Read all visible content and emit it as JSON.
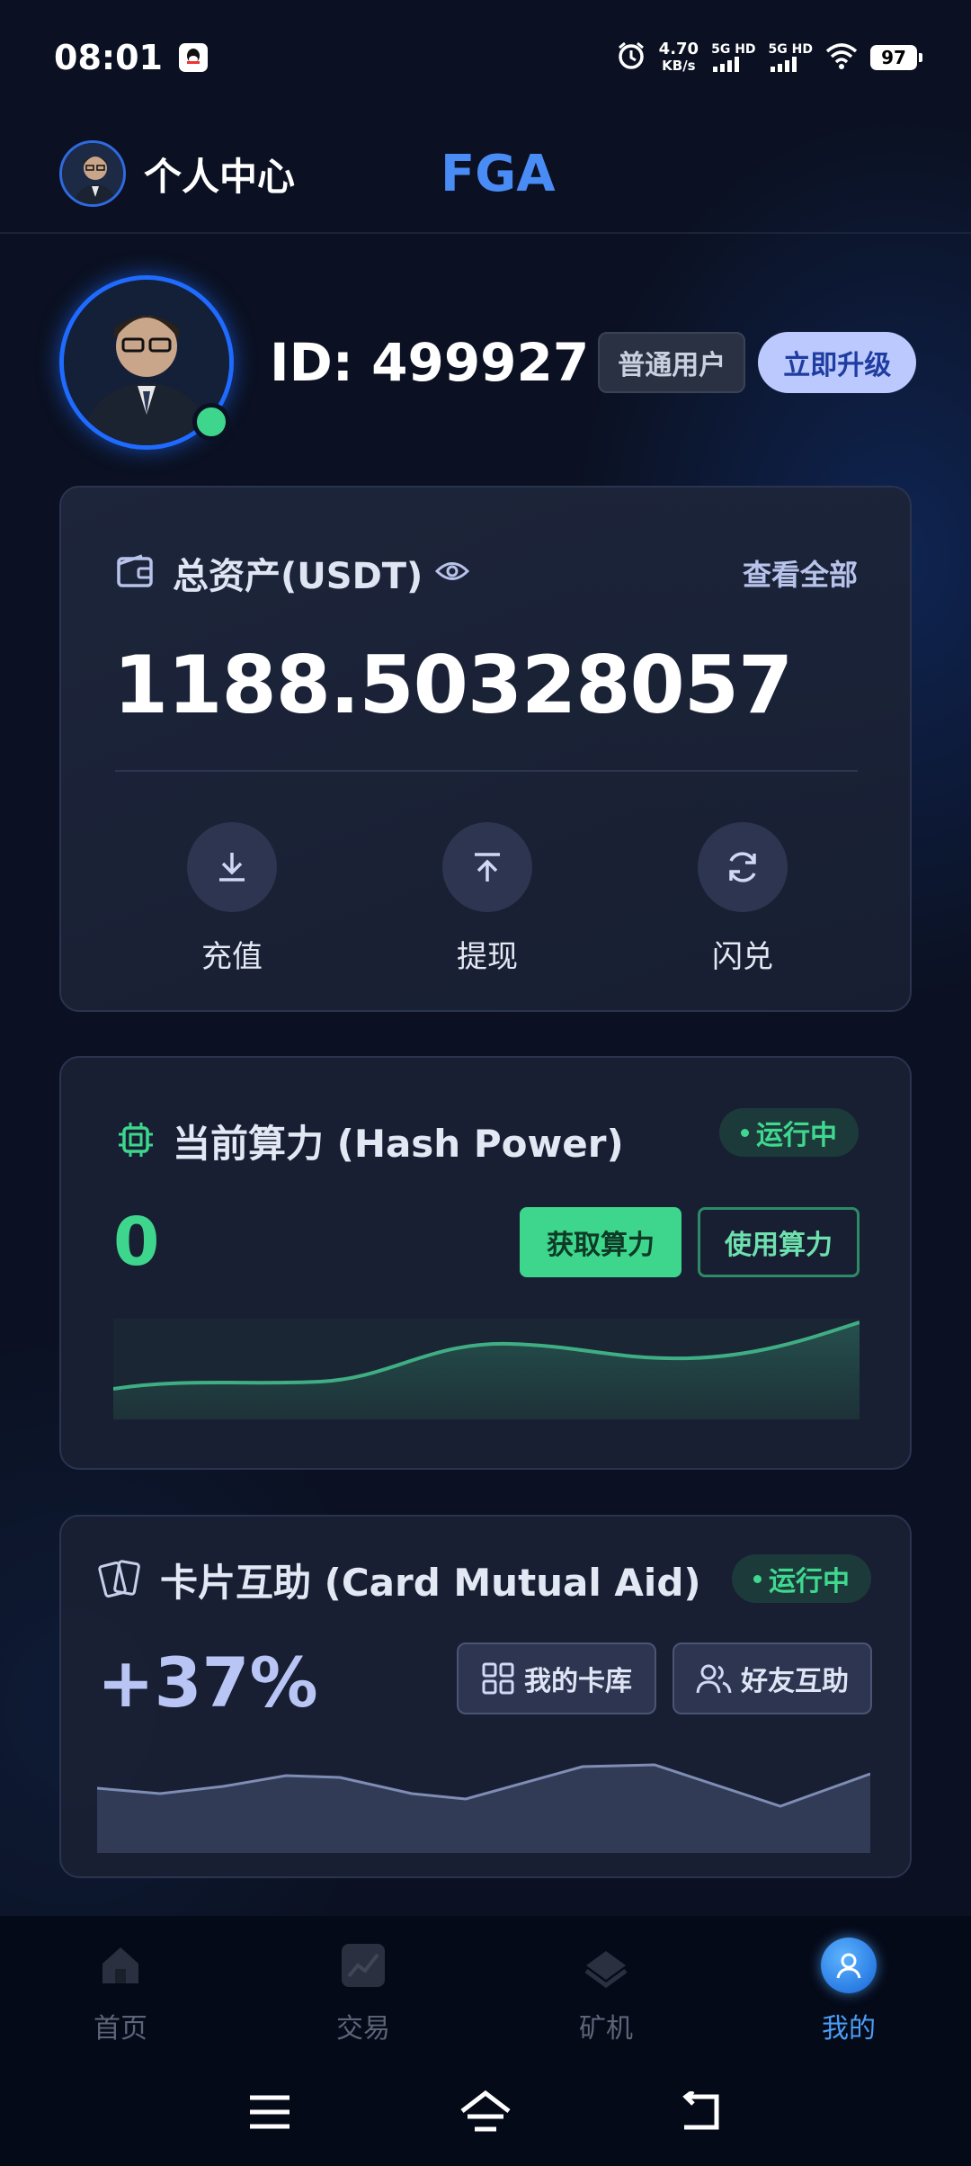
{
  "status_bar": {
    "time": "08:01",
    "net_speed_value": "4.70",
    "net_speed_unit": "KB/s",
    "sim1": "5G HD",
    "sim2": "5G HD",
    "battery": "97"
  },
  "header": {
    "title": "个人中心",
    "app_name": "FGA"
  },
  "profile": {
    "user_id": "ID: 499927",
    "tier": "普通用户",
    "upgrade_label": "立即升级",
    "online": true
  },
  "assets": {
    "label": "总资产(USDT)",
    "view_all": "查看全部",
    "total": "1188.50328057",
    "actions": [
      {
        "label": "充值",
        "icon": "download-icon"
      },
      {
        "label": "提现",
        "icon": "upload-icon"
      },
      {
        "label": "闪兑",
        "icon": "swap-icon"
      }
    ]
  },
  "hash_power": {
    "title": "当前算力 (Hash Power)",
    "status": "运行中",
    "value": "0",
    "get_label": "获取算力",
    "use_label": "使用算力"
  },
  "card_aid": {
    "title": "卡片互助 (Card Mutual Aid)",
    "status": "运行中",
    "value": "+37%",
    "library_label": "我的卡库",
    "friends_label": "好友互助"
  },
  "bottom_nav": [
    {
      "label": "首页",
      "icon": "home-icon",
      "active": false
    },
    {
      "label": "交易",
      "icon": "trade-chart-icon",
      "active": false
    },
    {
      "label": "矿机",
      "icon": "miner-icon",
      "active": false
    },
    {
      "label": "我的",
      "icon": "profile-icon",
      "active": true
    }
  ],
  "colors": {
    "accent_blue": "#4a8cf5",
    "accent_green": "#3dd68c",
    "background": "#0b1122",
    "card": "#1a2134"
  }
}
